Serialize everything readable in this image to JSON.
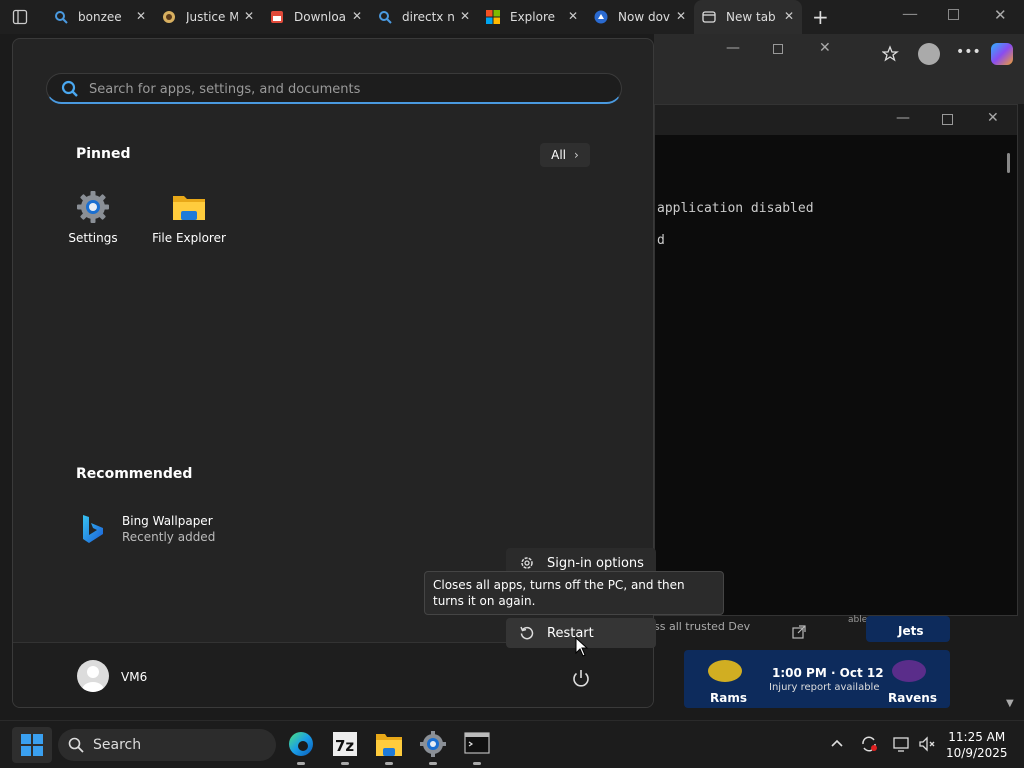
{
  "browser": {
    "tabs": [
      {
        "label": "bonzee",
        "icon": "search-icon"
      },
      {
        "label": "Justice M",
        "icon": "site-icon"
      },
      {
        "label": "Downloa",
        "icon": "site-icon"
      },
      {
        "label": "directx n",
        "icon": "search-icon"
      },
      {
        "label": "Explore",
        "icon": "microsoft-icon"
      },
      {
        "label": "Now dov",
        "icon": "site-icon"
      },
      {
        "label": "New tab",
        "icon": "newtab-icon"
      }
    ]
  },
  "terminal": {
    "lines": [
      "application disabled",
      "d"
    ]
  },
  "start_menu": {
    "search_placeholder": "Search for apps, settings, and documents",
    "pinned_title": "Pinned",
    "all_label": "All",
    "pinned_apps": [
      {
        "label": "Settings",
        "icon": "gear-icon"
      },
      {
        "label": "File Explorer",
        "icon": "folder-icon"
      }
    ],
    "recommended_title": "Recommended",
    "recommended": [
      {
        "title": "Bing Wallpaper",
        "subtitle": "Recently added",
        "icon": "bing-icon"
      }
    ],
    "user_name": "VM6"
  },
  "power_menu": {
    "items": [
      {
        "label": "Sign-in options",
        "icon": "gear-icon"
      },
      {
        "label": "Restart",
        "icon": "restart-icon"
      }
    ],
    "tooltip": "Closes all apps, turns off the PC, and then turns it on again."
  },
  "background_text": {
    "trusted": "ss all trusted Dev",
    "able": "able"
  },
  "widget": {
    "team1": "Jets",
    "team2": "Rams",
    "team3": "Ravens",
    "game_time": "1:00 PM · Oct 12",
    "game_note": "Injury report available"
  },
  "taskbar": {
    "search_label": "Search",
    "time": "11:25 AM",
    "date": "10/9/2025"
  }
}
